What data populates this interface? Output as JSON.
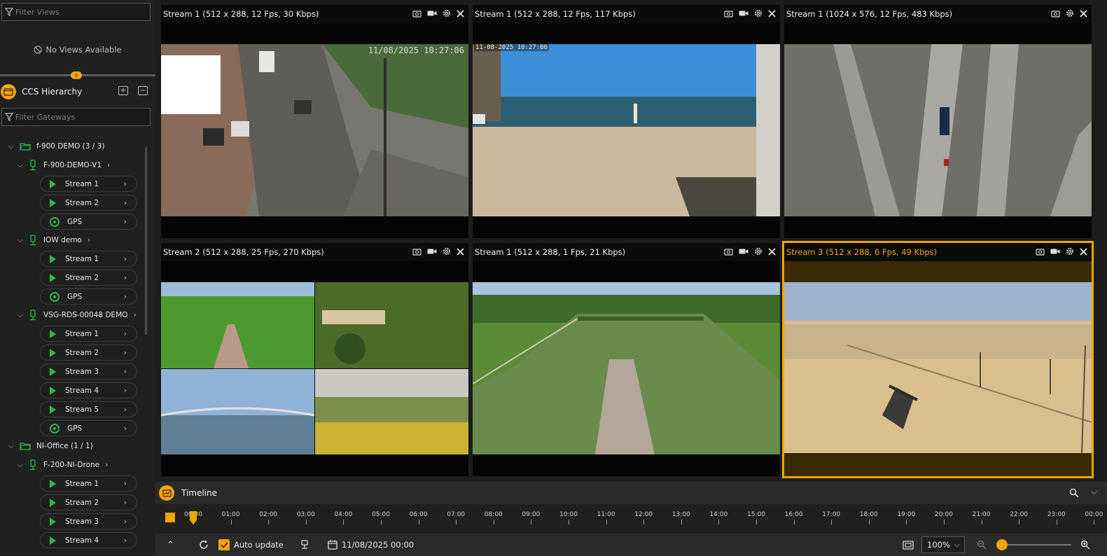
{
  "sidebar": {
    "filter_views_placeholder": "Filter Views",
    "no_views_text": "No Views Available",
    "hierarchy_title": "CCS Hierarchy",
    "filter_gateways_placeholder": "Filter Gateways",
    "groups": [
      {
        "label": "f-900 DEMO (3 / 3)",
        "devices": [
          {
            "label": "F-900-DEMO-V1",
            "items": [
              "Stream 1",
              "Stream 2",
              "GPS"
            ]
          },
          {
            "label": "IOW demo",
            "items": [
              "Stream 1",
              "Stream 2",
              "GPS"
            ]
          },
          {
            "label": "VSG-RDS-00048 DEMO",
            "items": [
              "Stream 1",
              "Stream 2",
              "Stream 3",
              "Stream 4",
              "Stream 5",
              "GPS"
            ]
          }
        ]
      },
      {
        "label": "NI-Office (1 / 1)",
        "devices": [
          {
            "label": "F-200-NI-Drone",
            "items": [
              "Stream 1",
              "Stream 2",
              "Stream 3",
              "Stream 4"
            ]
          }
        ]
      }
    ]
  },
  "tiles": [
    {
      "title": "Stream 1 (512 x 288, 12 Fps, 30 Kbps)",
      "overlay": "11/08/2025 10:27:06",
      "active": false
    },
    {
      "title": "Stream 1 (512 x 288, 12 Fps, 117 Kbps)",
      "overlay": "11-08-2025 10:27:06",
      "active": false
    },
    {
      "title": "Stream 1 (1024 x 576, 12 Fps, 483 Kbps)",
      "overlay": "",
      "active": false
    },
    {
      "title": "Stream 2 (512 x 288, 25 Fps, 270 Kbps)",
      "overlay": "",
      "active": false
    },
    {
      "title": "Stream 1 (512 x 288, 1 Fps, 21 Kbps)",
      "overlay": "",
      "active": false
    },
    {
      "title": "Stream 3 (512 x 288, 6 Fps, 49 Kbps)",
      "overlay": "",
      "active": true
    }
  ],
  "timeline": {
    "title": "Timeline",
    "hours": [
      "00:00",
      "01:00",
      "02:00",
      "03:00",
      "04:00",
      "05:00",
      "06:00",
      "07:00",
      "08:00",
      "09:00",
      "10:00",
      "11:00",
      "12:00",
      "13:00",
      "14:00",
      "15:00",
      "16:00",
      "17:00",
      "18:00",
      "19:00",
      "20:00",
      "21:00",
      "22:00",
      "23:00",
      "00:00"
    ],
    "auto_update_label": "Auto update",
    "auto_update_checked": true,
    "date_label": "11/08/2025 00:00",
    "zoom_value": "100%"
  },
  "colors": {
    "accent": "#f0a500",
    "play_green": "#2fb845",
    "background": "#1c1c1c"
  }
}
